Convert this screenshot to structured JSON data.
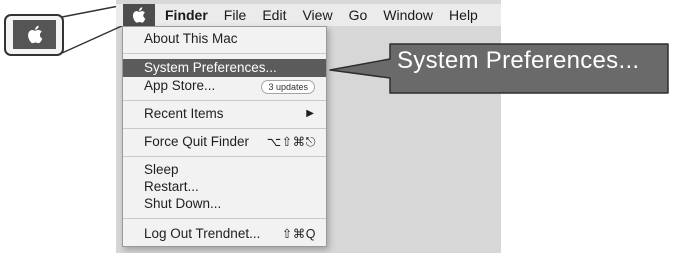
{
  "menubar": {
    "items": [
      "Finder",
      "File",
      "Edit",
      "View",
      "Go",
      "Window",
      "Help"
    ]
  },
  "apple_menu": {
    "items": [
      {
        "label": "About This Mac"
      },
      {
        "label": "System Preferences...",
        "highlighted": true
      },
      {
        "label": "App Store...",
        "badge": "3 updates"
      },
      {
        "label": "Recent Items",
        "submenu_arrow": "▶"
      },
      {
        "label": "Force Quit Finder",
        "shortcut": "⌥⇧⌘⎋"
      },
      {
        "label": "Sleep"
      },
      {
        "label": "Restart..."
      },
      {
        "label": "Shut Down..."
      },
      {
        "label": "Log Out Trendnet...",
        "shortcut": "⇧⌘Q"
      }
    ]
  },
  "callout": {
    "label": "System Preferences..."
  },
  "colors": {
    "highlight": "#5b5b5b",
    "menu_background": "#f2f2f2",
    "callout_fill": "#6a6a6a",
    "desktop": "#d7d7d7"
  },
  "icons": [
    "apple-logo-icon",
    "submenu-arrow-icon"
  ]
}
